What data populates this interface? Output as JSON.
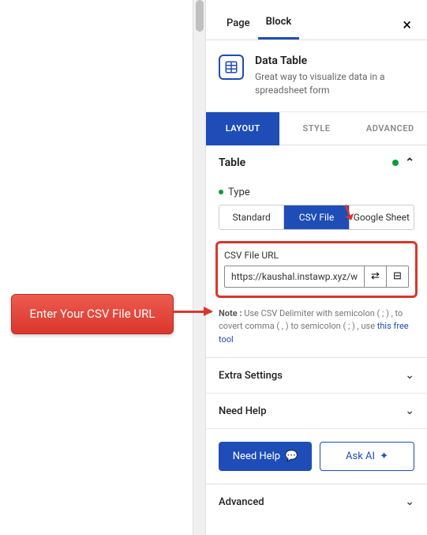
{
  "tabs": {
    "page": "Page",
    "block": "Block"
  },
  "block": {
    "title": "Data Table",
    "description": "Great way to visualize data in a spreadsheet form"
  },
  "sub_tabs": {
    "layout": "LAYOUT",
    "style": "STYLE",
    "advanced": "ADVANCED"
  },
  "section_table": "Table",
  "type": {
    "label": "Type",
    "options": {
      "standard": "Standard",
      "csv": "CSV File",
      "gsheet": "Google Sheet"
    }
  },
  "csv": {
    "label": "CSV File URL",
    "value": "https://kaushal.instawp.xyz/w"
  },
  "note": {
    "prefix": "Note :",
    "text": " Use CSV Delimiter with semicolon ( ; ) , to covert comma ( , ) to semicolon ( ; ) , use ",
    "link": "this free tool"
  },
  "sections": {
    "extra": "Extra Settings",
    "need_help": "Need Help",
    "advanced": "Advanced"
  },
  "buttons": {
    "need_help": "Need Help",
    "ask_ai": "Ask AI"
  },
  "callout": "Enter Your CSV File URL"
}
